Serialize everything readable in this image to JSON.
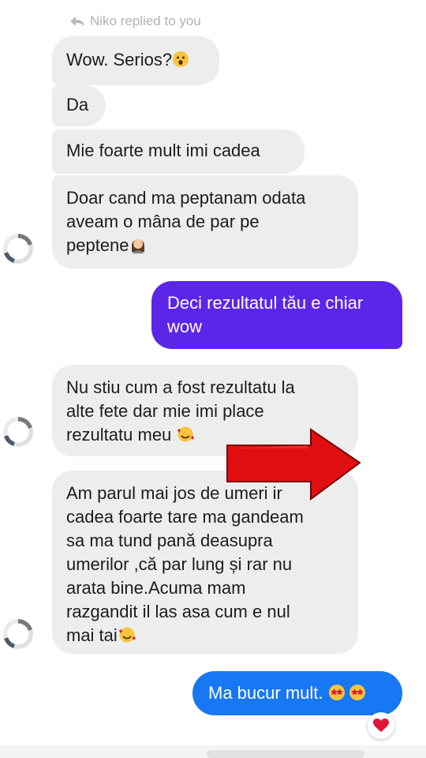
{
  "reply_header": {
    "text": "Niko replied to you"
  },
  "messages": [
    {
      "text": "Wow. Serios?"
    },
    {
      "text": "Da"
    },
    {
      "text": "Mie foarte mult imi cadea"
    },
    {
      "lines": [
        "Doar cand ma peptanam odata",
        "aveam o mâna de par pe",
        "peptene"
      ]
    },
    {
      "lines": [
        "Deci rezultatul tău e chiar",
        "wow"
      ]
    },
    {
      "lines": [
        "Nu stiu cum a fost rezultatu la",
        "alte fete dar mie imi place",
        "rezultatu meu"
      ]
    },
    {
      "lines": [
        "Am parul mai jos de umeri ir",
        "cadea foarte tare ma gandeam",
        "sa ma tund pană deasupra",
        "umerilor ,că par lung și rar nu",
        "arata bine.Acuma mam",
        "razgandit il las asa cum e nul",
        "mai tai"
      ]
    },
    {
      "text": "Ma bucur mult."
    }
  ],
  "colors": {
    "incoming_bubble": "#ededed",
    "outgoing_purple": "#5b26e8",
    "outgoing_blue": "#1877f2",
    "reaction_heart": "#e0173a",
    "overlay_arrow": "#e01010"
  },
  "icons": [
    "reply-arrow-icon",
    "astonished-face-emoji",
    "woman-emoji",
    "smiling-face-with-hearts-emoji",
    "star-struck-emoji",
    "heart-reaction-icon",
    "red-arrow"
  ]
}
